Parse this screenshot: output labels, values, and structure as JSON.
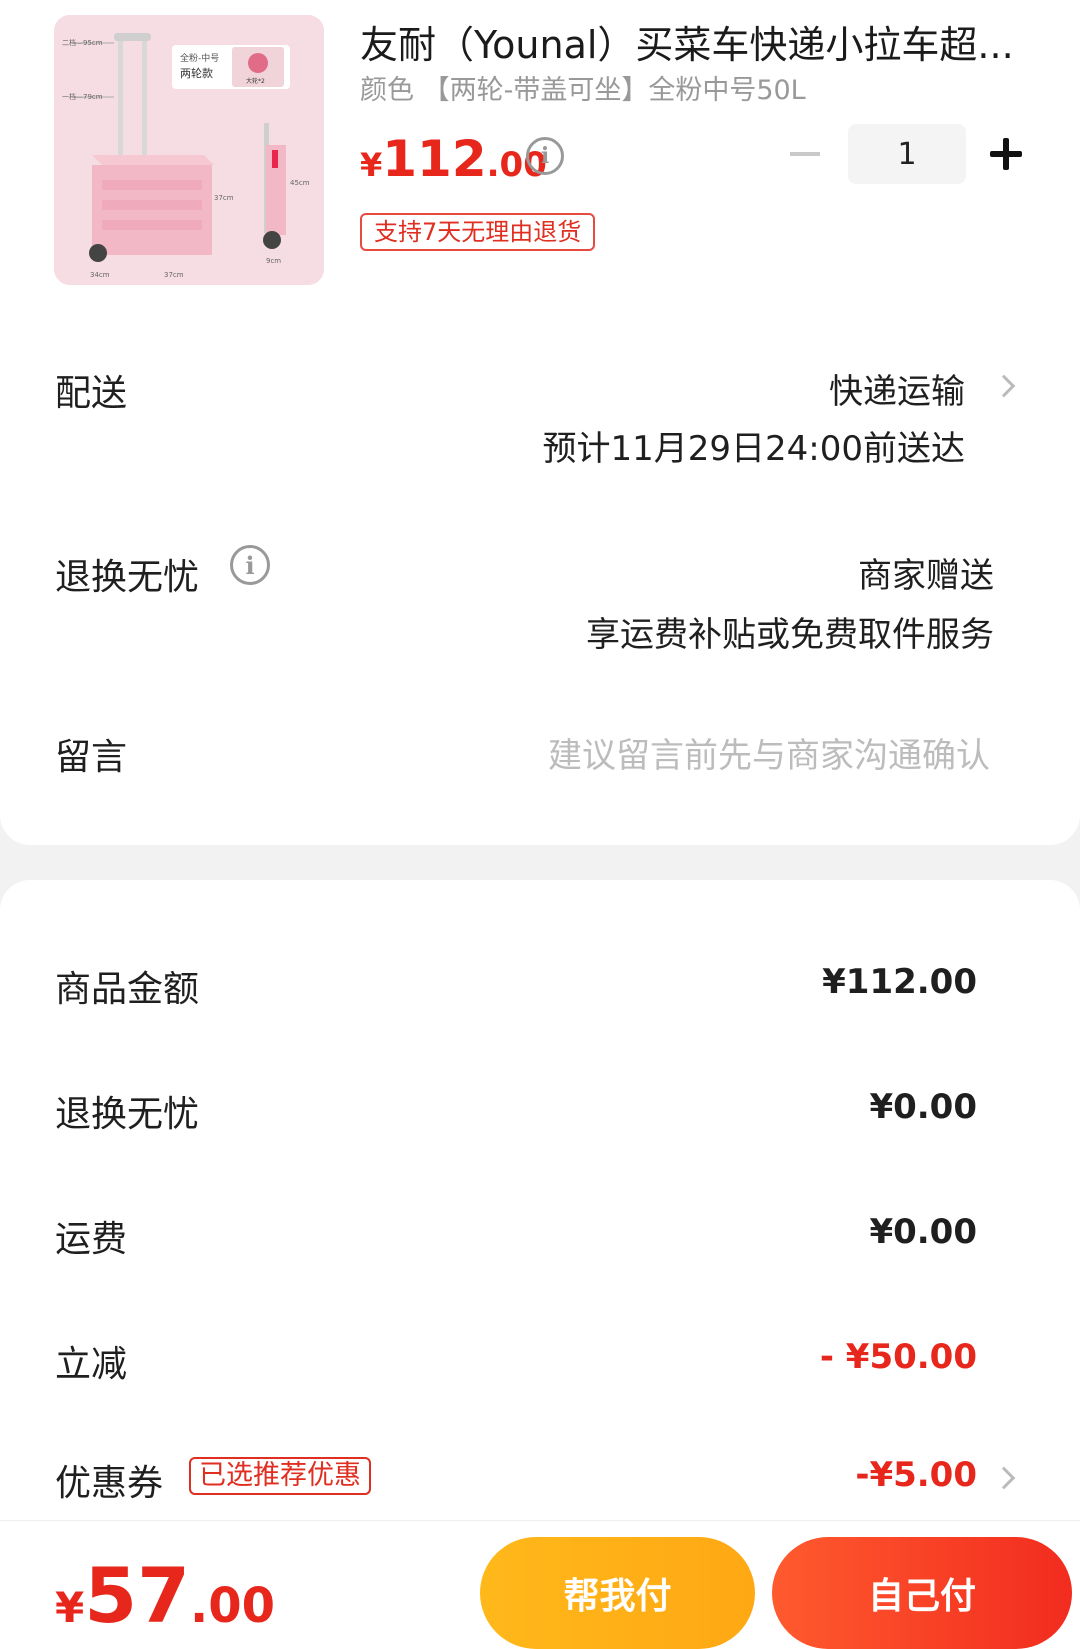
{
  "product": {
    "title": "友耐（Younal）买菜车快递小拉车超...",
    "spec": "颜色 【两轮-带盖可坐】全粉中号50L",
    "price_currency": "¥",
    "price_int": "112",
    "price_dec": ".00",
    "price_info_icon": "info-icon",
    "quantity": "1",
    "return_tag": "支持7天无理由退货",
    "image_labels": {
      "badge_line1": "全粉-中号",
      "badge_line2": "两轮款",
      "dim_top1": "二档—95cm",
      "dim_top2": "一档—79cm",
      "dim_h": "37cm",
      "dim_side": "45cm",
      "dim_w": "34cm",
      "dim_l": "37cm",
      "dim_s": "9cm",
      "wheel_label": "大轮*2"
    }
  },
  "delivery": {
    "label": "配送",
    "method": "快递运输",
    "estimate": "预计11月29日24:00前送达"
  },
  "worry_free": {
    "label": "退换无忧",
    "value": "商家赠送",
    "desc": "享运费补贴或免费取件服务"
  },
  "message": {
    "label": "留言",
    "placeholder": "建议留言前先与商家沟通确认"
  },
  "summary": {
    "goods_label": "商品金额",
    "goods_value": "¥112.00",
    "worry_label": "退换无忧",
    "worry_value": "¥0.00",
    "shipping_label": "运费",
    "shipping_value": "¥0.00",
    "discount_label": "立减",
    "discount_value": "- ¥50.00",
    "coupon_label": "优惠券",
    "coupon_tag": "已选推荐优惠",
    "coupon_value": "-¥5.00"
  },
  "bottom": {
    "total_currency": "¥",
    "total_int": "57",
    "total_dec": ".00",
    "help_pay": "帮我付",
    "self_pay": "自己付"
  },
  "colors": {
    "accent_red": "#e8271c",
    "accent_orange": "#ffb81a",
    "tag_red": "#e02e20",
    "muted_gray": "#999999"
  }
}
